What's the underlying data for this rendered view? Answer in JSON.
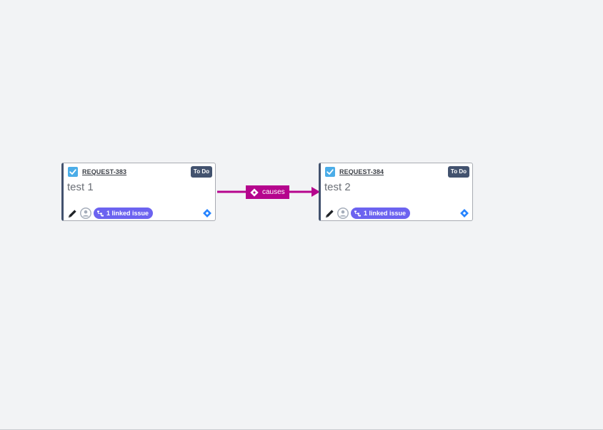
{
  "cards": [
    {
      "key": "REQUEST-383",
      "status": "To Do",
      "summary": "test 1",
      "linked_issues": "1 linked issue"
    },
    {
      "key": "REQUEST-384",
      "status": "To Do",
      "summary": "test 2",
      "linked_issues": "1 linked issue"
    }
  ],
  "link": {
    "label": "causes"
  },
  "colors": {
    "background": "#f2f3f5",
    "link": "#b5058d",
    "status_badge": "#42526e",
    "linked_badge": "#6c63f0",
    "type_icon": "#4bade8"
  },
  "icons": {
    "type": "checkbox-task-icon",
    "edit": "pencil-icon",
    "avatar": "user-avatar-icon",
    "linked": "link-tree-icon",
    "jira": "jira-diamond-icon"
  }
}
